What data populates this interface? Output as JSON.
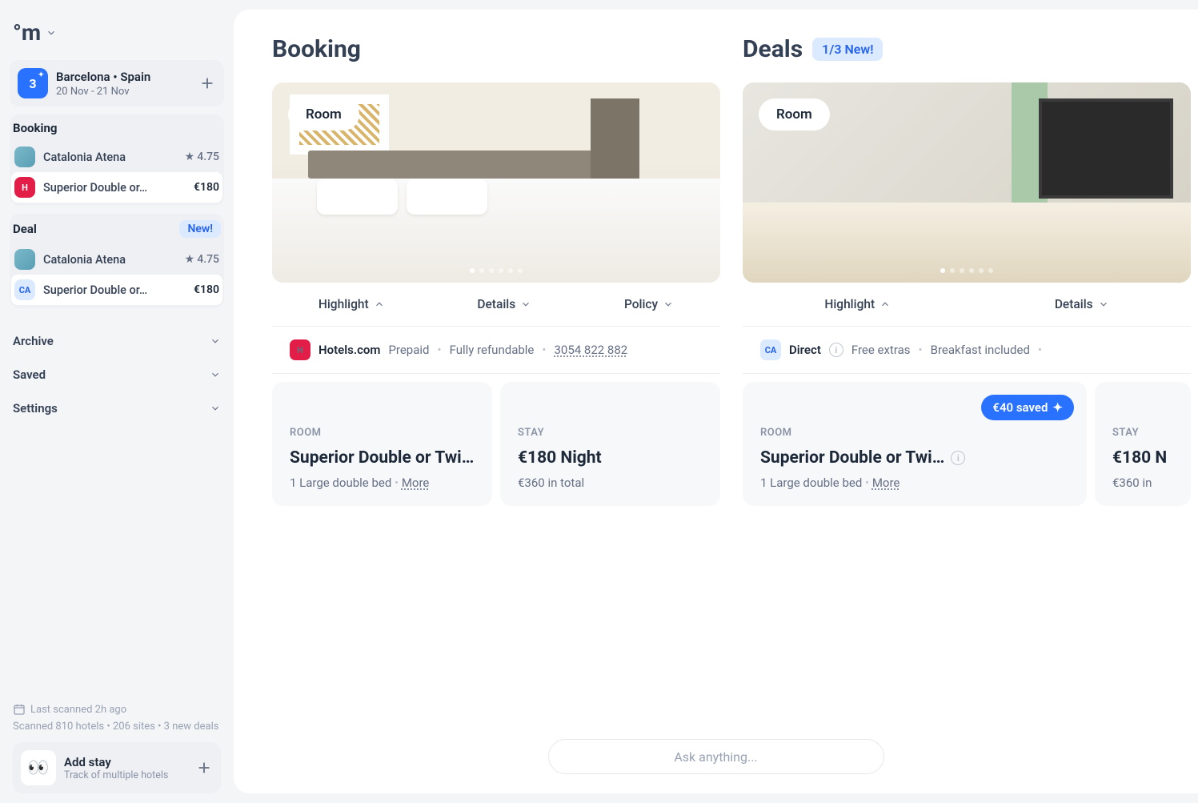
{
  "logo": "°m",
  "trip": {
    "icon_text": "3",
    "destination": "Barcelona  •  Spain",
    "dates": "20 Nov - 21 Nov"
  },
  "sidebar": {
    "booking_label": "Booking",
    "deal_label": "Deal",
    "new_label": "New!",
    "hotel_name": "Catalonia Atena",
    "rating": "4.75",
    "room_label": "Superior Double or…",
    "price": "€180",
    "nav": {
      "archive": "Archive",
      "saved": "Saved",
      "settings": "Settings"
    },
    "footer": {
      "last_scan": "Last scanned 2h ago",
      "stats": "Scanned 810 hotels  •  206 sites  •  3 new deals",
      "add_title": "Add stay",
      "add_sub": "Track of multiple hotels"
    }
  },
  "main": {
    "booking_h": "Booking",
    "deals_h": "Deals",
    "deals_badge": "1/3  New!",
    "room_pill": "Room",
    "tabs": {
      "highlight": "Highlight",
      "details": "Details",
      "policy": "Policy"
    },
    "booking": {
      "provider": "Hotels.com",
      "meta1": "Prepaid",
      "meta2": "Fully refundable",
      "ref": "3054 822 882",
      "room": {
        "eyebrow": "ROOM",
        "title": "Superior Double or Twi…",
        "sub1": "1 Large double bed",
        "more": "More"
      },
      "stay": {
        "eyebrow": "STAY",
        "title": "€180 Night",
        "sub": "€360 in total"
      }
    },
    "deal": {
      "provider_badge": "CA",
      "provider": "Direct",
      "meta1": "Free extras",
      "meta2": "Breakfast included",
      "saved_pill": "€40 saved",
      "room": {
        "eyebrow": "ROOM",
        "title": "Superior Double or Twi…",
        "sub1": "1 Large double bed",
        "more": "More"
      },
      "stay": {
        "eyebrow": "STAY",
        "title": "€180 N",
        "sub": "€360 in"
      }
    },
    "ask_placeholder": "Ask anything..."
  }
}
